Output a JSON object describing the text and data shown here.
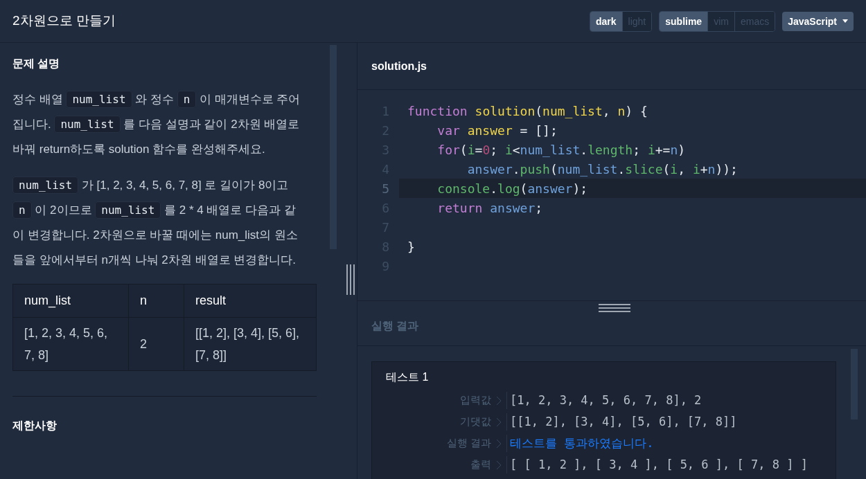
{
  "header": {
    "title": "2차원으로 만들기",
    "theme": [
      {
        "label": "dark",
        "selected": true
      },
      {
        "label": "light",
        "selected": false
      }
    ],
    "keymap": [
      {
        "label": "sublime",
        "selected": true
      },
      {
        "label": "vim",
        "selected": false
      },
      {
        "label": "emacs",
        "selected": false
      }
    ],
    "language": "JavaScript"
  },
  "description": {
    "heading": "문제 설명",
    "paragraphs": [
      [
        {
          "kind": "text",
          "text": "정수 배열 "
        },
        {
          "kind": "code",
          "text": "num_list"
        },
        {
          "kind": "text",
          "text": " 와 정수 "
        },
        {
          "kind": "code",
          "text": "n"
        },
        {
          "kind": "text",
          "text": " 이 매개변수로 주어집니다. "
        },
        {
          "kind": "code",
          "text": "num_list"
        },
        {
          "kind": "text",
          "text": " 를 다음 설명과 같이 2차원 배열로 바꿔 return하도록 solution 함수를 완성해주세요."
        }
      ],
      [
        {
          "kind": "code",
          "text": "num_list"
        },
        {
          "kind": "text",
          "text": " 가 [1, 2, 3, 4, 5, 6, 7, 8] 로 길이가 8이고 "
        },
        {
          "kind": "code",
          "text": "n"
        },
        {
          "kind": "text",
          "text": " 이 2이므로 "
        },
        {
          "kind": "code",
          "text": "num_list"
        },
        {
          "kind": "text",
          "text": " 를 2 * 4 배열로 다음과 같이 변경합니다. 2차원으로 바꿀 때에는 num_list의 원소들을 앞에서부터 n개씩 나눠 2차원 배열로 변경합니다."
        }
      ]
    ],
    "table": {
      "columns": [
        "num_list",
        "n",
        "result"
      ],
      "rows": [
        [
          "[1, 2, 3, 4, 5, 6, 7, 8]",
          "2",
          "[[1, 2], [3, 4], [5, 6], [7, 8]]"
        ]
      ]
    },
    "next_heading": "제한사항"
  },
  "editor": {
    "filename": "solution.js",
    "lines": [
      {
        "number": "1",
        "active": false,
        "tokens": [
          {
            "kind": "kw",
            "text": "function"
          },
          {
            "kind": "fn",
            "text": " solution"
          },
          {
            "kind": "plain",
            "text": "("
          },
          {
            "kind": "fn",
            "text": "num_list"
          },
          {
            "kind": "plain",
            "text": ", "
          },
          {
            "kind": "fn",
            "text": "n"
          },
          {
            "kind": "plain",
            "text": ") {"
          }
        ]
      },
      {
        "number": "2",
        "active": false,
        "tokens": [
          {
            "kind": "kw",
            "text": "    var"
          },
          {
            "kind": "fn",
            "text": " answer"
          },
          {
            "kind": "plain",
            "text": " = [];"
          }
        ]
      },
      {
        "number": "3",
        "active": false,
        "tokens": [
          {
            "kind": "kw",
            "text": "    for"
          },
          {
            "kind": "plain",
            "text": "("
          },
          {
            "kind": "prop",
            "text": "i"
          },
          {
            "kind": "plain",
            "text": "="
          },
          {
            "kind": "num",
            "text": "0"
          },
          {
            "kind": "plain",
            "text": "; "
          },
          {
            "kind": "prop",
            "text": "i"
          },
          {
            "kind": "plain",
            "text": "<"
          },
          {
            "kind": "var",
            "text": "num_list"
          },
          {
            "kind": "plain",
            "text": "."
          },
          {
            "kind": "prop",
            "text": "length"
          },
          {
            "kind": "plain",
            "text": "; "
          },
          {
            "kind": "prop",
            "text": "i"
          },
          {
            "kind": "plain",
            "text": "+="
          },
          {
            "kind": "var",
            "text": "n"
          },
          {
            "kind": "plain",
            "text": ")"
          }
        ]
      },
      {
        "number": "4",
        "active": false,
        "tokens": [
          {
            "kind": "var",
            "text": "        answer"
          },
          {
            "kind": "plain",
            "text": "."
          },
          {
            "kind": "prop",
            "text": "push"
          },
          {
            "kind": "plain",
            "text": "("
          },
          {
            "kind": "var",
            "text": "num_list"
          },
          {
            "kind": "plain",
            "text": "."
          },
          {
            "kind": "prop",
            "text": "slice"
          },
          {
            "kind": "plain",
            "text": "("
          },
          {
            "kind": "prop",
            "text": "i"
          },
          {
            "kind": "plain",
            "text": ", "
          },
          {
            "kind": "prop",
            "text": "i"
          },
          {
            "kind": "plain",
            "text": "+"
          },
          {
            "kind": "var",
            "text": "n"
          },
          {
            "kind": "plain",
            "text": "));"
          }
        ]
      },
      {
        "number": "5",
        "active": true,
        "tokens": [
          {
            "kind": "prop",
            "text": "    console"
          },
          {
            "kind": "plain",
            "text": "."
          },
          {
            "kind": "prop",
            "text": "log"
          },
          {
            "kind": "plain",
            "text": "("
          },
          {
            "kind": "var",
            "text": "answer"
          },
          {
            "kind": "plain",
            "text": ");"
          }
        ]
      },
      {
        "number": "6",
        "active": false,
        "tokens": [
          {
            "kind": "kw",
            "text": "    return"
          },
          {
            "kind": "var",
            "text": " answer"
          },
          {
            "kind": "plain",
            "text": ";"
          }
        ]
      },
      {
        "number": "7",
        "active": false
      },
      {
        "number": "8",
        "active": false,
        "tokens": [
          {
            "kind": "plain",
            "text": "}"
          }
        ]
      },
      {
        "number": "9",
        "active": false
      }
    ]
  },
  "results": {
    "heading": "실행 결과",
    "test": {
      "title": "테스트 1",
      "rows": [
        {
          "label": "입력값",
          "kind": "plain",
          "value": "[1, 2, 3, 4, 5, 6, 7, 8], 2"
        },
        {
          "label": "기댓값",
          "kind": "plain",
          "value": "[[1, 2], [3, 4], [5, 6], [7, 8]]"
        },
        {
          "label": "실행 결과",
          "kind": "pass",
          "value": "테스트를 통과하였습니다."
        },
        {
          "label": "출력",
          "kind": "plain",
          "value": "[ [ 1, 2 ], [ 3, 4 ], [ 5, 6 ], [ 7, 8 ] ]"
        }
      ]
    }
  }
}
